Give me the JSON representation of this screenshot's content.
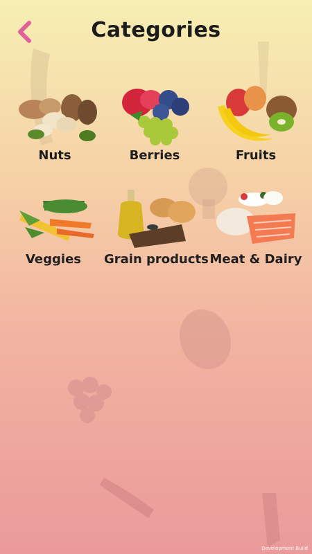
{
  "header": {
    "title": "Categories",
    "back_icon": "chevron-left-icon"
  },
  "categories": [
    {
      "label": "Nuts",
      "icon": "nuts-image"
    },
    {
      "label": "Berries",
      "icon": "berries-image"
    },
    {
      "label": "Fruits",
      "icon": "fruits-image"
    },
    {
      "label": "Veggies",
      "icon": "veggies-image"
    },
    {
      "label": "Grain products",
      "icon": "grain-products-image"
    },
    {
      "label": "Meat & Dairy",
      "icon": "meat-dairy-image"
    }
  ],
  "footer": {
    "build_label": "Development Build"
  },
  "colors": {
    "accent_back": "#e0609a",
    "gradient_top": "#f6efb3",
    "gradient_bottom": "#ea9a9a"
  }
}
